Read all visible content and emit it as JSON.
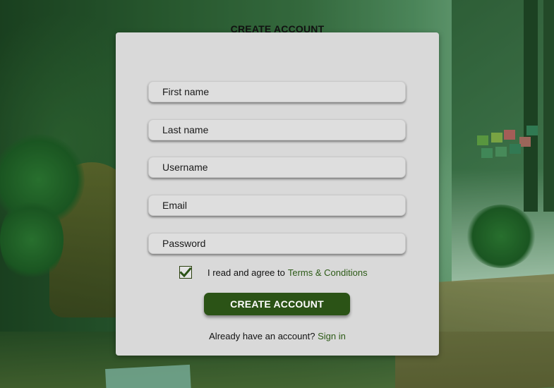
{
  "form": {
    "title": "CREATE ACCOUNT",
    "fields": [
      {
        "name": "first-name",
        "placeholder": "First name",
        "value": ""
      },
      {
        "name": "last-name",
        "placeholder": "Last name",
        "value": ""
      },
      {
        "name": "username",
        "placeholder": "Username",
        "value": ""
      },
      {
        "name": "email",
        "placeholder": "Email",
        "value": ""
      },
      {
        "name": "password",
        "placeholder": "Password",
        "value": ""
      }
    ],
    "terms": {
      "checked": true,
      "text": "I read and agree to",
      "link_text": "Terms & Conditions"
    },
    "submit_label": "CREATE ACCOUNT",
    "signin": {
      "text": "Already have an account?",
      "link_text": "Sign in"
    }
  },
  "colors": {
    "accent": "#2b5316",
    "link": "#2c5a16",
    "card": "#d9d9d9"
  },
  "icons": {
    "checkbox": "checkmark-icon"
  }
}
